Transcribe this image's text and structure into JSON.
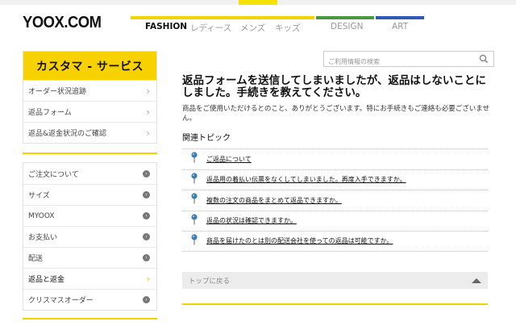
{
  "logo": "YOOX.COM",
  "nav": {
    "fashion": "FASHION",
    "ladies": "レディース",
    "mens": "メンズ",
    "kids": "キッズ",
    "design": "DESIGN",
    "art": "ART"
  },
  "sidebar": {
    "header": "カスタマ - サービス",
    "top_items": [
      {
        "label": "オーダー状況追跡"
      },
      {
        "label": "返品フォーム"
      },
      {
        "label": "返品&返金状況のご確認"
      }
    ],
    "bottom_items": [
      {
        "label": "ご注文について"
      },
      {
        "label": "サイズ"
      },
      {
        "label": "MYOOX"
      },
      {
        "label": "お支払い"
      },
      {
        "label": "配送"
      },
      {
        "label": "返品と返金"
      },
      {
        "label": "クリスマスオーダー"
      }
    ]
  },
  "search": {
    "placeholder": "ご利用情報の検索"
  },
  "main": {
    "title": "返品フォームを送信してしまいましたが、返品はしないことにしました。手続きを教えてください。",
    "description": "商品をご使用いただけるとのこと、ありがとうございます。特にお手続きもご連絡も必要ございません。",
    "related_title": "関連トピック",
    "topics": [
      {
        "label": "ご返品について"
      },
      {
        "label": "返品用の着払い伝票をなくしてしまいました。再度入手できますか。"
      },
      {
        "label": "複数の注文の商品をまとめて返品できますか。"
      },
      {
        "label": "返品の状況は確認できますか。"
      },
      {
        "label": "商品を届けたのとは別の配送会社を使っての返品は可能ですか。"
      }
    ],
    "back_to_top": "トップに戻る"
  },
  "colors": {
    "brand_yellow": "#f7d100",
    "design_green": "#4a9a3b",
    "art_blue": "#2c5bb5",
    "pin_blue": "#3d7fb0"
  }
}
